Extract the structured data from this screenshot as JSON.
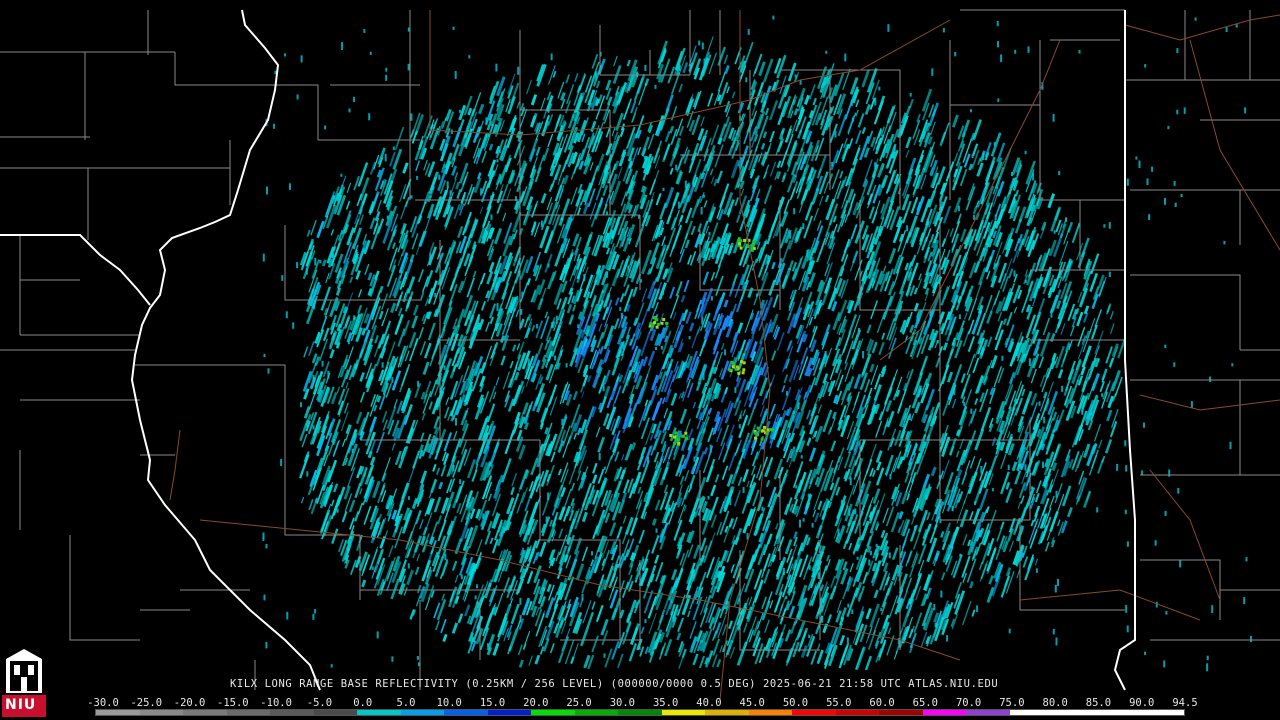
{
  "product_caption": "KILX LONG RANGE BASE REFLECTIVITY (0.25KM / 256 LEVEL) (000000/0000 0.5 DEG) 2025-06-21 21:58 UTC  ATLAS.NIU.EDU",
  "scale": {
    "labels": [
      "-30.0",
      "-25.0",
      "-20.0",
      "-15.0",
      "-10.0",
      "-5.0",
      "0.0",
      "5.0",
      "10.0",
      "15.0",
      "20.0",
      "25.0",
      "30.0",
      "35.0",
      "40.0",
      "45.0",
      "50.0",
      "55.0",
      "60.0",
      "65.0",
      "70.0",
      "75.0",
      "80.0",
      "85.0",
      "90.0",
      "94.5"
    ],
    "colors": [
      "#9a9a9a",
      "#8a8a8a",
      "#7a7a7a",
      "#6a6a6a",
      "#5a5a5a",
      "#4a4a4a",
      "#00c8c8",
      "#00a0f0",
      "#0060f0",
      "#0020d0",
      "#00e000",
      "#00b000",
      "#008800",
      "#e8e800",
      "#e0b000",
      "#ff8000",
      "#ff0000",
      "#d00000",
      "#a00000",
      "#ff00ff",
      "#9040d0",
      "#ffffff",
      "#ffffff",
      "#ffffff",
      "#ffffff"
    ]
  },
  "logo_text": "NIU",
  "colors": {
    "background": "#000000",
    "county_lines": "#8a8a8a",
    "state_lines": "#ffffff",
    "roads": "#8b4a2a",
    "echo_cyan": "#00d8d8",
    "echo_blue": "#1a8cff"
  }
}
